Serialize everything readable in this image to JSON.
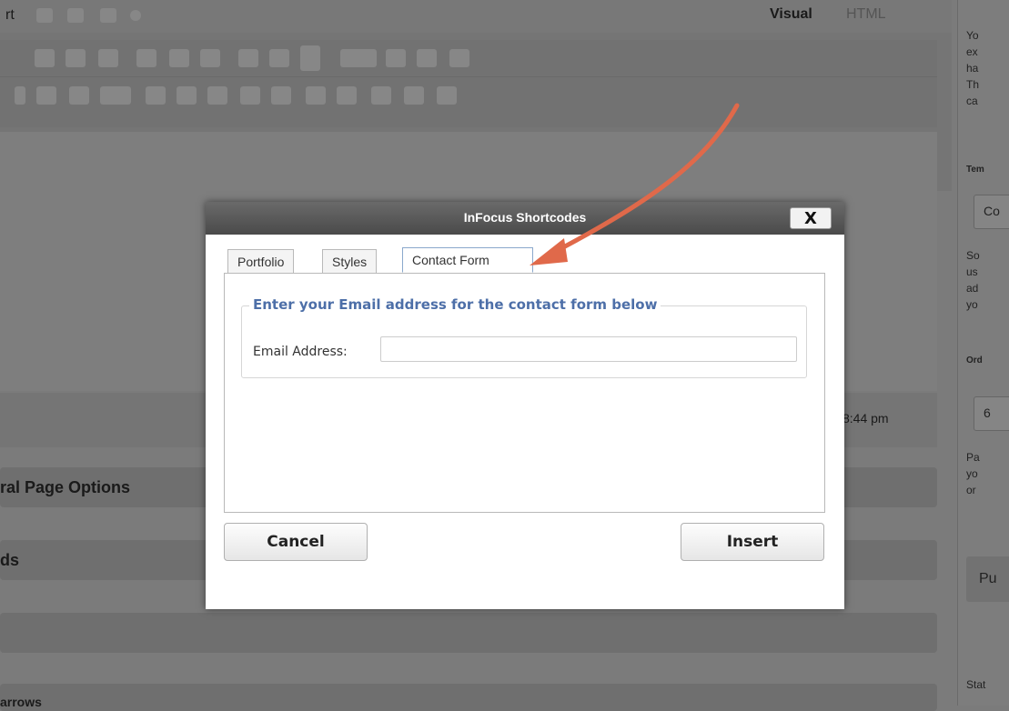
{
  "editor": {
    "toolbar_partial_label": "rt",
    "view_tabs": [
      "Visual",
      "HTML"
    ],
    "timestamp_partial": "8:44 pm",
    "section_general_page_options": "ral Page Options",
    "section_fields_partial": "ds",
    "bottom_partial": "arrows"
  },
  "right_column": {
    "text_lines_top": [
      "Yo",
      "ex",
      "ha",
      "Th",
      "ca"
    ],
    "label_template": "Tem",
    "box_template": "Co",
    "text_lines_mid": [
      "So",
      "us",
      "ad",
      "yo"
    ],
    "label_order": "Ord",
    "box_order": "6",
    "text_lines_bottom": [
      "Pa",
      "yo",
      "or"
    ],
    "publish_label": "Pu",
    "status_label": "Stat"
  },
  "modal": {
    "title": "InFocus Shortcodes",
    "close_label": "X",
    "tabs": [
      {
        "label": "Portfolio",
        "active": false
      },
      {
        "label": "Styles",
        "active": false
      },
      {
        "label": "Contact Form",
        "active": true
      }
    ],
    "fieldset_legend": "Enter your Email address for the contact form below",
    "email_label": "Email Address:",
    "email_value": "",
    "email_placeholder": "",
    "cancel_label": "Cancel",
    "insert_label": "Insert"
  },
  "colors": {
    "accent_legend": "#4d6fa8",
    "annotation_arrow": "#e0694a",
    "header_bar": "#4a4a4a"
  }
}
